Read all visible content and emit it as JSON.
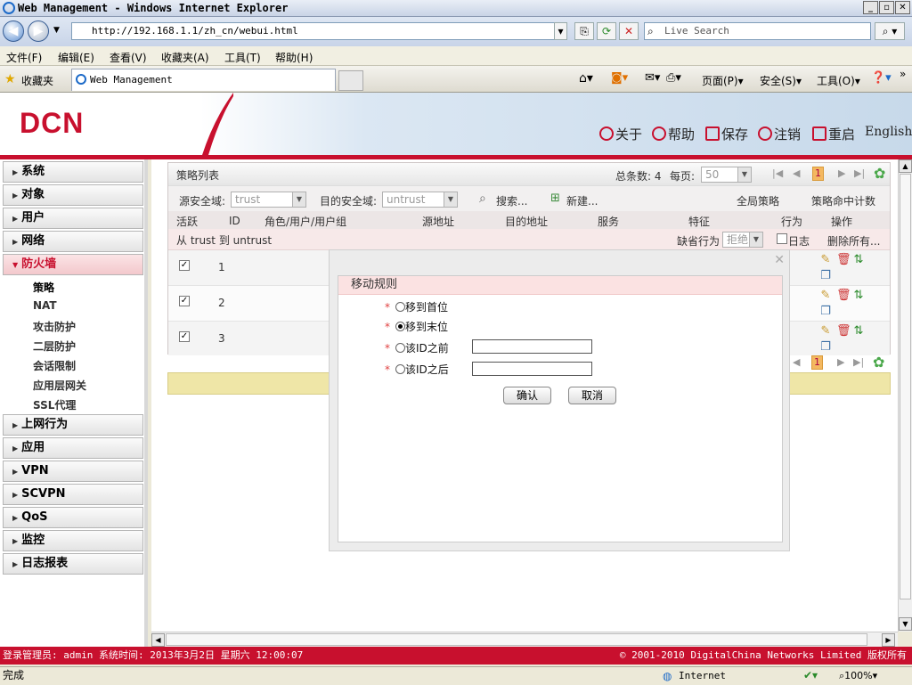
{
  "window": {
    "title": "Web Management - Windows Internet Explorer"
  },
  "browser": {
    "url": "http://192.168.1.1/zh_cn/webui.html",
    "search_placeholder": "Live Search",
    "menu": [
      "文件(F)",
      "编辑(E)",
      "查看(V)",
      "收藏夹(A)",
      "工具(T)",
      "帮助(H)"
    ],
    "favorites_label": "收藏夹",
    "tab_title": "Web Management",
    "cmd": {
      "page": "页面(P)",
      "safety": "安全(S)",
      "tools": "工具(O)"
    }
  },
  "header": {
    "logo": "DCN",
    "links": {
      "about": "关于",
      "help": "帮助",
      "save": "保存",
      "logout": "注销",
      "reboot": "重启",
      "english": "English"
    }
  },
  "sidebar": {
    "items": [
      "系统",
      "对象",
      "用户",
      "网络",
      "防火墙",
      "上网行为",
      "应用",
      "VPN",
      "SCVPN",
      "QoS",
      "监控",
      "日志报表"
    ],
    "active": "防火墙",
    "subitems": [
      "策略",
      "NAT",
      "攻击防护",
      "二层防护",
      "会话限制",
      "应用层网关",
      "SSL代理"
    ]
  },
  "policy": {
    "title": "策略列表",
    "total_label": "总条数: 4",
    "per_page_label": "每页:",
    "per_page": "50",
    "page": "1",
    "src_zone_label": "源安全域:",
    "src_zone": "trust",
    "dst_zone_label": "目的安全域:",
    "dst_zone": "untrust",
    "search": "搜索...",
    "new": "新建...",
    "global_policy": "全局策略",
    "hit_count": "策略命中计数",
    "columns": [
      "活跃",
      "ID",
      "角色/用户/用户组",
      "源地址",
      "目的地址",
      "服务",
      "特征",
      "行为",
      "操作"
    ],
    "group_label": "从 trust 到 untrust",
    "default_action_label": "缺省行为",
    "default_action": "拒绝",
    "log_label": "日志",
    "delete_all": "删除所有...",
    "rows": [
      {
        "id": "1"
      },
      {
        "id": "2"
      },
      {
        "id": "3"
      }
    ]
  },
  "modal": {
    "title": "移动规则",
    "options": [
      "移到首位",
      "移到末位",
      "该ID之前",
      "该ID之后"
    ],
    "selected": "移到末位",
    "confirm": "确认",
    "cancel": "取消"
  },
  "status": {
    "admin": "登录管理员: admin 系统时间: 2013年3月2日 星期六 12:00:07",
    "copyright": "© 2001-2010 DigitalChina Networks Limited 版权所有",
    "ie_left": "完成",
    "zone": "Internet",
    "zoom": "100%"
  },
  "colors": {
    "brand": "#c8102e",
    "modal_header": "#fbe2e2",
    "page_active": "#f4b860"
  }
}
